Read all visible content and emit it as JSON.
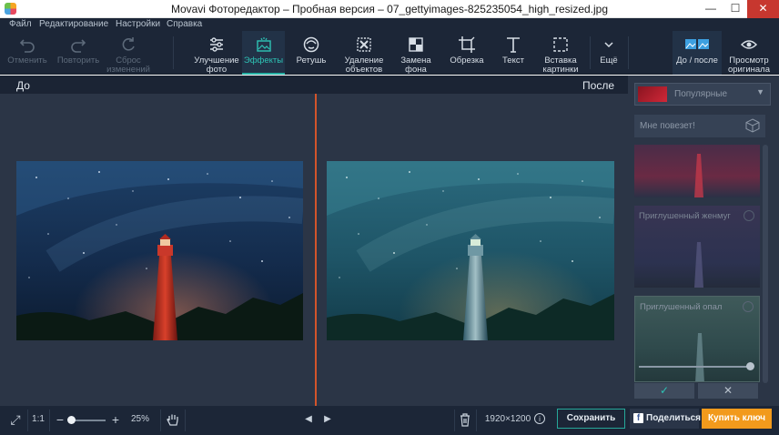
{
  "window": {
    "title": "Movavi Фоторедактор – Пробная версия – 07_gettyimages-825235054_high_resized.jpg",
    "min": "—",
    "max": "☐",
    "close": "✕"
  },
  "menu": [
    "Файл",
    "Редактирование",
    "Настройки",
    "Справка"
  ],
  "toolbar": {
    "undo": "Отменить",
    "redo": "Повторить",
    "reset_line1": "Сброс",
    "reset_line2": "изменений",
    "enhance_line1": "Улучшение",
    "enhance_line2": "фото",
    "effects": "Эффекты",
    "retouch": "Ретушь",
    "remove_line1": "Удаление",
    "remove_line2": "объектов",
    "bg_line1": "Замена",
    "bg_line2": "фона",
    "crop": "Обрезка",
    "text": "Текст",
    "insert_line1": "Вставка",
    "insert_line2": "картинки",
    "more": "Ещё",
    "before_after": "До / после",
    "view_line1": "Просмотр",
    "view_line2": "оригинала"
  },
  "canvas": {
    "before_label": "До",
    "after_label": "После"
  },
  "effects_panel": {
    "category": "Популярные",
    "lucky": "Мне повезет!",
    "presets": [
      {
        "label": ""
      },
      {
        "label": "Приглушенный женмуг"
      },
      {
        "label": "Приглушенный опал"
      }
    ],
    "apply": "✓",
    "cancel": "✕"
  },
  "statusbar": {
    "fit": "⤢",
    "one_to_one": "1:1",
    "zoom_out": "−",
    "zoom_in": "+",
    "zoom_value": "25%",
    "zoom_fraction": 0.05,
    "prev": "◀",
    "next": "▶",
    "dimensions": "1920×1200",
    "info": "i",
    "save": "Сохранить",
    "share": "Поделиться",
    "share_fb": "f",
    "buy": "Купить ключ"
  },
  "colors": {
    "accent": "#25b0a4",
    "divider": "#d3542b",
    "buy": "#f29a1c"
  }
}
